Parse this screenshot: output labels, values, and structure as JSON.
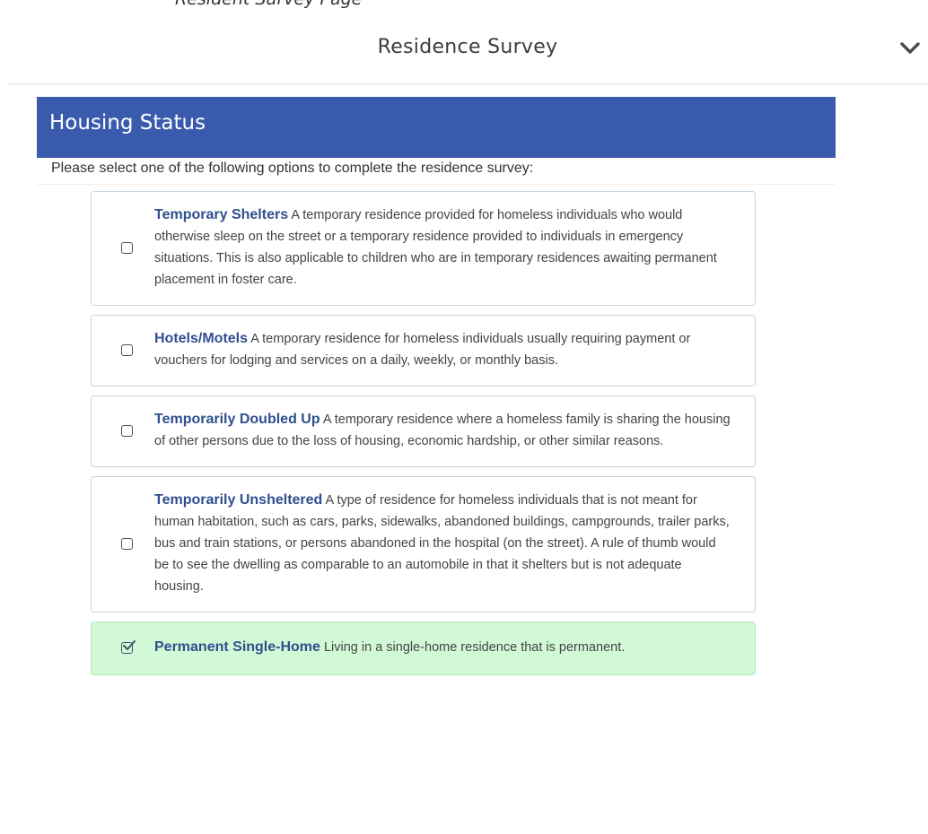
{
  "page_top_fragment": "Resident Survey Page",
  "header": {
    "title": "Residence Survey",
    "toggle_icon": "chevron-down-icon"
  },
  "section": {
    "title": "Housing Status",
    "instructions": "Please select one of the following options to complete the residence survey:"
  },
  "options": [
    {
      "title": "Temporary Shelters",
      "description": "A temporary residence provided for homeless individuals who would otherwise sleep on the street or a temporary residence provided to individuals in emergency situations. This is also applicable to children who are in temporary residences awaiting permanent placement in foster care.",
      "checked": false
    },
    {
      "title": "Hotels/Motels",
      "description": "A temporary residence for homeless individuals usually requiring payment or vouchers for lodging and services on a daily, weekly, or monthly basis.",
      "checked": false
    },
    {
      "title": "Temporarily Doubled Up",
      "description": "A temporary residence where a homeless family is sharing the housing of other persons due to the loss of housing, economic hardship, or other similar reasons.",
      "checked": false
    },
    {
      "title": "Temporarily Unsheltered",
      "description": "A type of residence for homeless individuals that is not meant for human habitation, such as cars, parks, sidewalks, abandoned buildings, campgrounds, trailer parks, bus and train stations, or persons abandoned in the hospital (on the street). A rule of thumb would be to see the dwelling as comparable to an automobile in that it shelters but is not adequate housing.",
      "checked": false
    },
    {
      "title": "Permanent Single-Home",
      "description": "Living in a single-home residence that is permanent.",
      "checked": true
    }
  ],
  "colors": {
    "section_bar": "#3a5bad",
    "option_title": "#2f4f8f",
    "selected_background": "#d2f9d6",
    "option_border": "#c6d5e4"
  }
}
